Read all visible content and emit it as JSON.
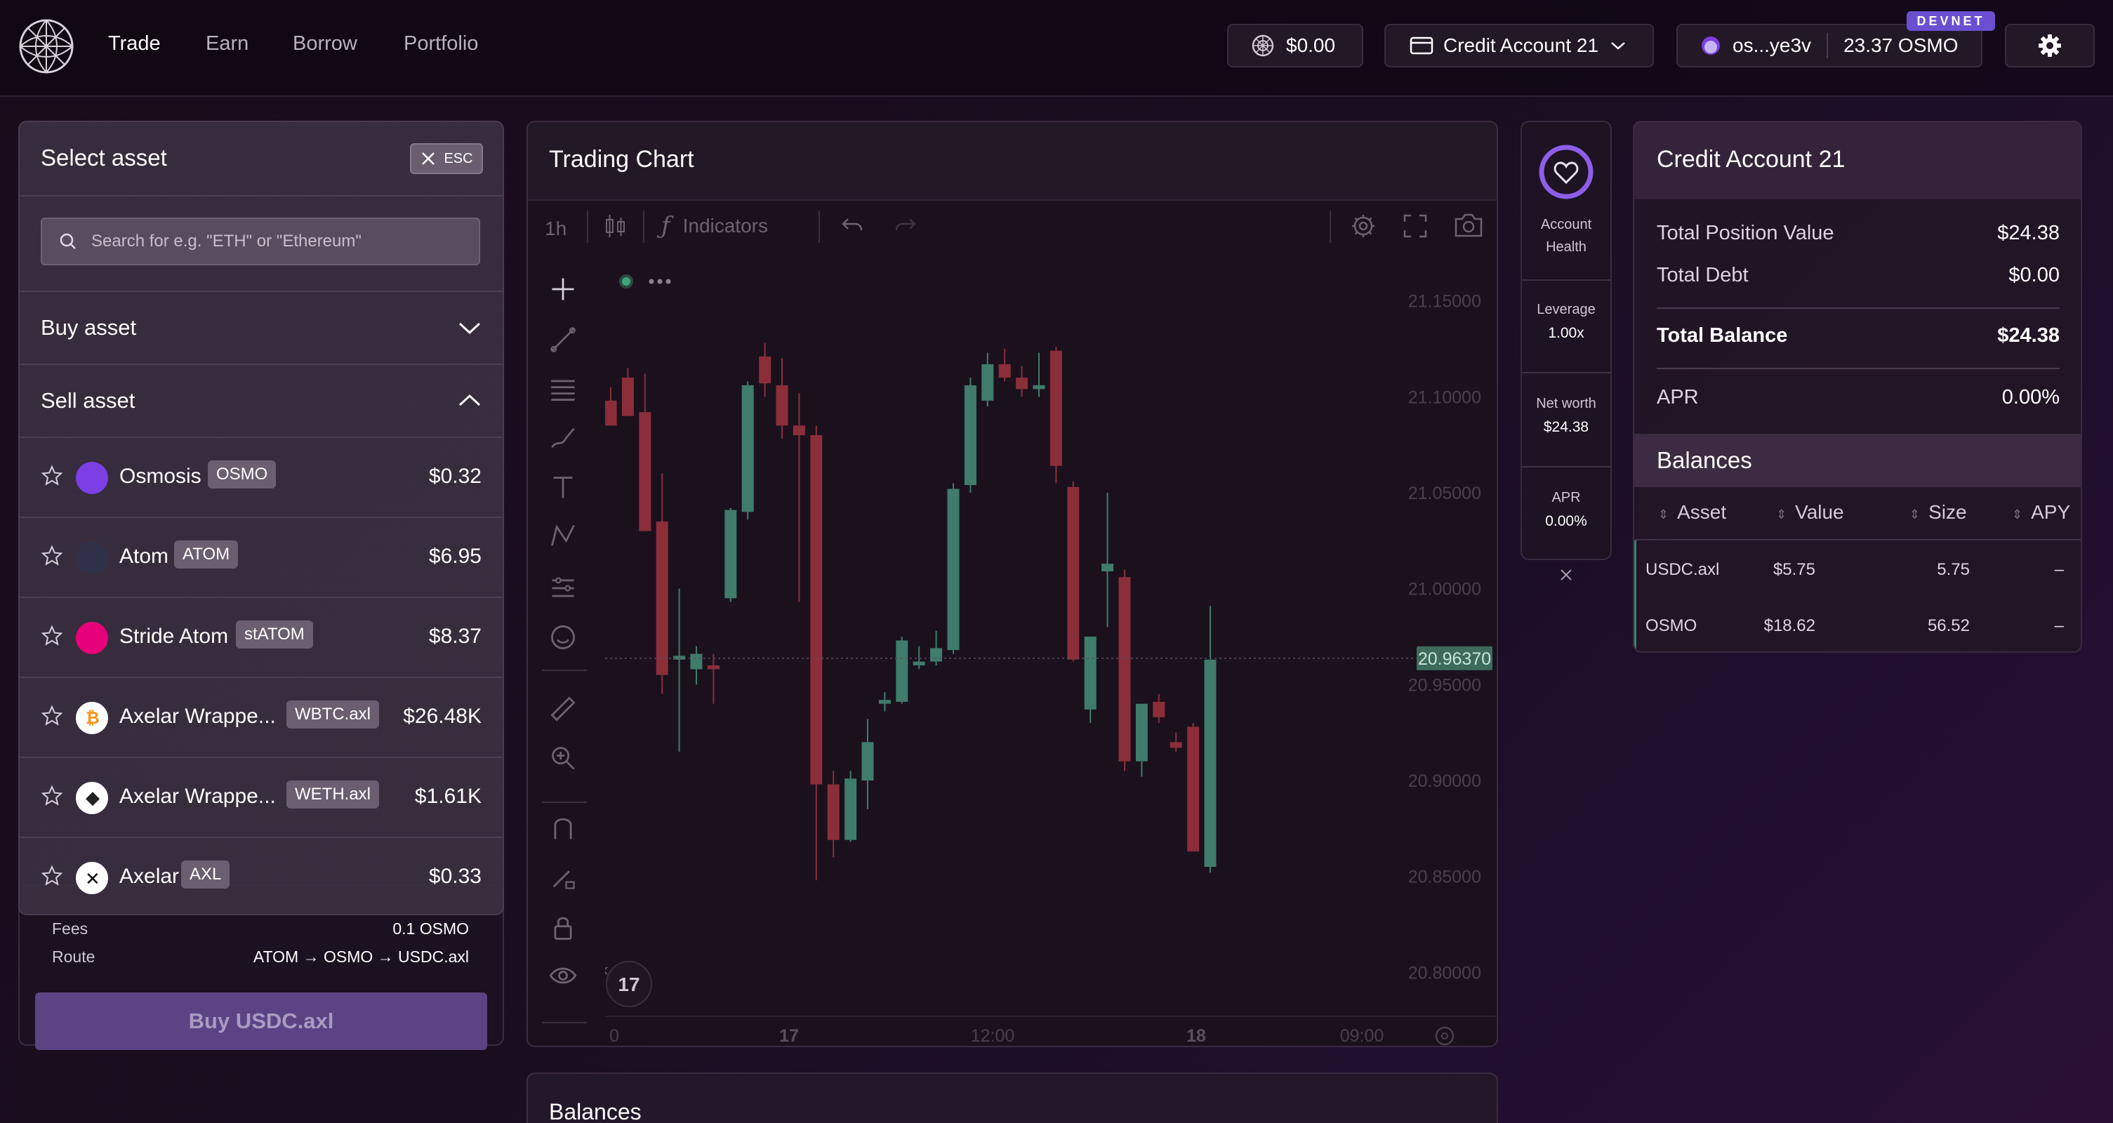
{
  "nav": {
    "items": [
      "Trade",
      "Earn",
      "Borrow",
      "Portfolio"
    ]
  },
  "header": {
    "rewards": "$0.00",
    "account": "Credit Account 21",
    "wallet_address": "os...ye3v",
    "wallet_balance": "23.37 OSMO",
    "network_badge": "DEVNET"
  },
  "select_asset": {
    "title": "Select asset",
    "close_label": "ESC",
    "search_placeholder": "Search for e.g. \"ETH\" or \"Ethereum\"",
    "buy_section": "Buy asset",
    "sell_section": "Sell asset",
    "assets": [
      {
        "name": "Osmosis",
        "symbol": "OSMO",
        "price": "$0.32",
        "icon_color": "#7b3fe4",
        "icon": "osmosis-icon"
      },
      {
        "name": "Atom",
        "symbol": "ATOM",
        "price": "$6.95",
        "icon_color": "#2e3148",
        "icon": "atom-icon"
      },
      {
        "name": "Stride Atom",
        "symbol": "stATOM",
        "price": "$8.37",
        "icon_color": "#e6007a",
        "icon": "stride-icon"
      },
      {
        "name": "Axelar Wrappe...",
        "symbol": "WBTC.axl",
        "price": "$26.48K",
        "icon_color": "#f7931a",
        "icon": "bitcoin-icon"
      },
      {
        "name": "Axelar Wrappe...",
        "symbol": "WETH.axl",
        "price": "$1.61K",
        "icon_color": "#ffffff",
        "icon": "ethereum-icon"
      },
      {
        "name": "Axelar",
        "symbol": "AXL",
        "price": "$0.33",
        "icon_color": "#ffffff",
        "icon": "axelar-icon"
      }
    ]
  },
  "order": {
    "fees_label": "Fees",
    "fees_value": "0.1 OSMO",
    "route_label": "Route",
    "route_value": "ATOM → OSMO → USDC.axl",
    "buy_button": "Buy USDC.axl"
  },
  "chart": {
    "title": "Trading Chart",
    "interval": "1h",
    "indicators": "Indicators",
    "current_price": "20.96370",
    "y_ticks": [
      "21.15000",
      "21.10000",
      "21.05000",
      "21.00000",
      "20.95000",
      "20.90000",
      "20.85000",
      "20.80000"
    ],
    "x_ticks": [
      "0",
      "17",
      "12:00",
      "18",
      "09:00"
    ]
  },
  "chart_data": {
    "type": "candlestick",
    "title": "",
    "ylim": [
      20.78,
      21.17
    ],
    "up_color": "#3f7c6a",
    "down_color": "#8b2e3a",
    "candles": [
      {
        "o": 21.098,
        "h": 21.105,
        "l": 21.085,
        "c": 21.085
      },
      {
        "o": 21.11,
        "h": 21.115,
        "l": 21.09,
        "c": 21.09
      },
      {
        "o": 21.092,
        "h": 21.112,
        "l": 21.03,
        "c": 21.03
      },
      {
        "o": 21.035,
        "h": 21.06,
        "l": 20.945,
        "c": 20.955
      },
      {
        "o": 20.963,
        "h": 21.0,
        "l": 20.915,
        "c": 20.965
      },
      {
        "o": 20.958,
        "h": 20.97,
        "l": 20.95,
        "c": 20.966
      },
      {
        "o": 20.96,
        "h": 20.966,
        "l": 20.94,
        "c": 20.958
      },
      {
        "o": 20.995,
        "h": 21.042,
        "l": 20.993,
        "c": 21.041
      },
      {
        "o": 21.04,
        "h": 21.108,
        "l": 21.036,
        "c": 21.106
      },
      {
        "o": 21.121,
        "h": 21.128,
        "l": 21.1,
        "c": 21.107
      },
      {
        "o": 21.106,
        "h": 21.12,
        "l": 21.078,
        "c": 21.085
      },
      {
        "o": 21.085,
        "h": 21.102,
        "l": 20.993,
        "c": 21.08
      },
      {
        "o": 21.08,
        "h": 21.085,
        "l": 20.848,
        "c": 20.898
      },
      {
        "o": 20.898,
        "h": 20.905,
        "l": 20.86,
        "c": 20.869
      },
      {
        "o": 20.869,
        "h": 20.905,
        "l": 20.868,
        "c": 20.901
      },
      {
        "o": 20.9,
        "h": 20.932,
        "l": 20.885,
        "c": 20.92
      },
      {
        "o": 20.94,
        "h": 20.946,
        "l": 20.936,
        "c": 20.942
      },
      {
        "o": 20.941,
        "h": 20.975,
        "l": 20.94,
        "c": 20.973
      },
      {
        "o": 20.96,
        "h": 20.97,
        "l": 20.958,
        "c": 20.962
      },
      {
        "o": 20.962,
        "h": 20.978,
        "l": 20.96,
        "c": 20.969
      },
      {
        "o": 20.968,
        "h": 21.055,
        "l": 20.966,
        "c": 21.052
      },
      {
        "o": 21.054,
        "h": 21.11,
        "l": 21.05,
        "c": 21.106
      },
      {
        "o": 21.098,
        "h": 21.123,
        "l": 21.095,
        "c": 21.117
      },
      {
        "o": 21.117,
        "h": 21.125,
        "l": 21.108,
        "c": 21.11
      },
      {
        "o": 21.11,
        "h": 21.116,
        "l": 21.1,
        "c": 21.104
      },
      {
        "o": 21.104,
        "h": 21.123,
        "l": 21.1,
        "c": 21.106
      },
      {
        "o": 21.124,
        "h": 21.126,
        "l": 21.055,
        "c": 21.064
      },
      {
        "o": 21.053,
        "h": 21.056,
        "l": 20.962,
        "c": 20.963
      },
      {
        "o": 20.937,
        "h": 20.955,
        "l": 20.93,
        "c": 20.975
      },
      {
        "o": 21.009,
        "h": 21.05,
        "l": 20.98,
        "c": 21.013
      },
      {
        "o": 21.006,
        "h": 21.01,
        "l": 20.905,
        "c": 20.91
      },
      {
        "o": 20.91,
        "h": 20.94,
        "l": 20.902,
        "c": 20.94
      },
      {
        "o": 20.941,
        "h": 20.945,
        "l": 20.93,
        "c": 20.933
      },
      {
        "o": 20.92,
        "h": 20.925,
        "l": 20.915,
        "c": 20.917
      },
      {
        "o": 20.928,
        "h": 20.93,
        "l": 20.865,
        "c": 20.863
      },
      {
        "o": 20.855,
        "h": 20.991,
        "l": 20.852,
        "c": 20.963
      }
    ]
  },
  "health": {
    "label": "Account Health",
    "leverage_label": "Leverage",
    "leverage_value": "1.00x",
    "networth_label": "Net worth",
    "networth_value": "$24.38",
    "apr_label": "APR",
    "apr_value": "0.00%"
  },
  "credit": {
    "title": "Credit Account 21",
    "rows": [
      {
        "label": "Total Position Value",
        "value": "$24.38"
      },
      {
        "label": "Total Debt",
        "value": "$0.00"
      },
      {
        "label": "Total Balance",
        "value": "$24.38"
      },
      {
        "label": "APR",
        "value": "0.00%"
      }
    ],
    "balances_title": "Balances",
    "columns": [
      "Asset",
      "Value",
      "Size",
      "APY"
    ],
    "balances": [
      {
        "asset": "USDC.axl",
        "value": "$5.75",
        "size": "5.75",
        "apy": "–"
      },
      {
        "asset": "OSMO",
        "value": "$18.62",
        "size": "56.52",
        "apy": "–"
      }
    ]
  },
  "bottom": {
    "balances_title": "Balances"
  }
}
